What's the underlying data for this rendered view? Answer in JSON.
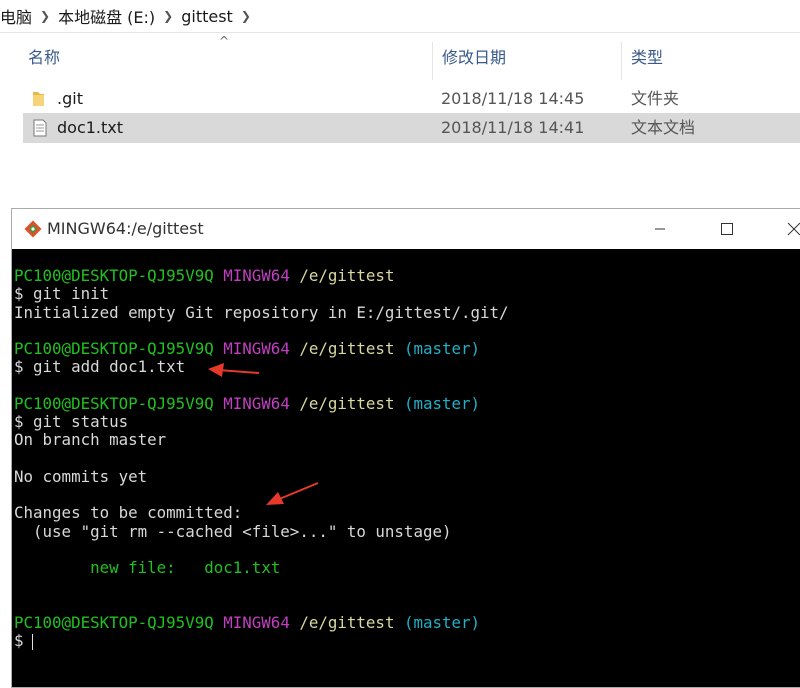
{
  "explorer": {
    "breadcrumb": [
      "电脑",
      "本地磁盘 (E:)",
      "gittest"
    ],
    "columns": {
      "name": "名称",
      "date": "修改日期",
      "type": "类型"
    },
    "files": [
      {
        "name": ".git",
        "date": "2018/11/18 14:45",
        "type": "文件夹",
        "icon": "folder-icon",
        "selected": false
      },
      {
        "name": "doc1.txt",
        "date": "2018/11/18 14:41",
        "type": "文本文档",
        "icon": "text-file-icon",
        "selected": true
      }
    ]
  },
  "terminal": {
    "title": "MINGW64:/e/gittest",
    "prompt_user": "PC100@DESKTOP-QJ95V9Q",
    "prompt_env": "MINGW64",
    "prompt_path": "/e/gittest",
    "prompt_branch": "(master)",
    "lines": {
      "cmd1": "$ git init",
      "out1": "Initialized empty Git repository in E:/gittest/.git/",
      "cmd2": "$ git add doc1.txt",
      "cmd3": "$ git status",
      "out3a": "On branch master",
      "out3b": "No commits yet",
      "out3c": "Changes to be committed:",
      "out3d": "  (use \"git rm --cached <file>...\" to unstage)",
      "new_file_label": "new file:",
      "new_file_name": "doc1.txt",
      "final_prompt": "$"
    }
  },
  "colors": {
    "prompt_user": "#20c020",
    "prompt_env": "#c040c0",
    "prompt_branch": "#20b0c8",
    "annotation_arrow": "#e53a2a"
  }
}
